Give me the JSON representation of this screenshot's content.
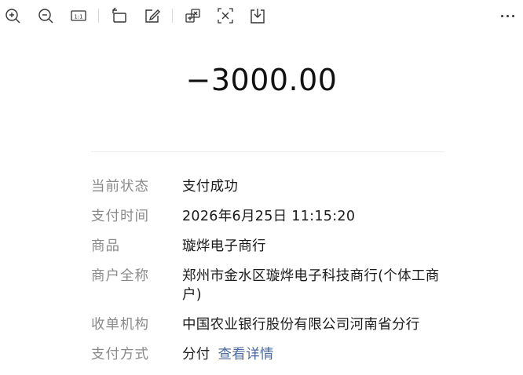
{
  "toolbar": {
    "buttons": [
      {
        "name": "zoom-in-icon"
      },
      {
        "name": "zoom-out-icon"
      },
      {
        "name": "actual-size-icon",
        "label": "1:1"
      },
      {
        "name": "rotate-icon"
      },
      {
        "name": "edit-icon"
      },
      {
        "name": "screenshot-translate-icon"
      },
      {
        "name": "text-extract-icon"
      },
      {
        "name": "download-icon"
      }
    ],
    "more": "more-icon"
  },
  "transaction": {
    "amount": "−3000.00"
  },
  "details": {
    "status_label": "当前状态",
    "status_value": "支付成功",
    "time_label": "支付时间",
    "time_value": "2026年6月25日 11:15:20",
    "product_label": "商品",
    "product_value": "璇烨电子商行",
    "merchant_label": "商户全称",
    "merchant_value": "郑州市金水区璇烨电子科技商行(个体工商户)",
    "acquirer_label": "收单机构",
    "acquirer_value": "中国农业银行股份有限公司河南省分行",
    "method_label": "支付方式",
    "method_value": "分付",
    "method_link": "查看详情"
  },
  "colors": {
    "label": "#8a8a8a",
    "value": "#1a1a1a",
    "link": "#4b6a9b"
  }
}
